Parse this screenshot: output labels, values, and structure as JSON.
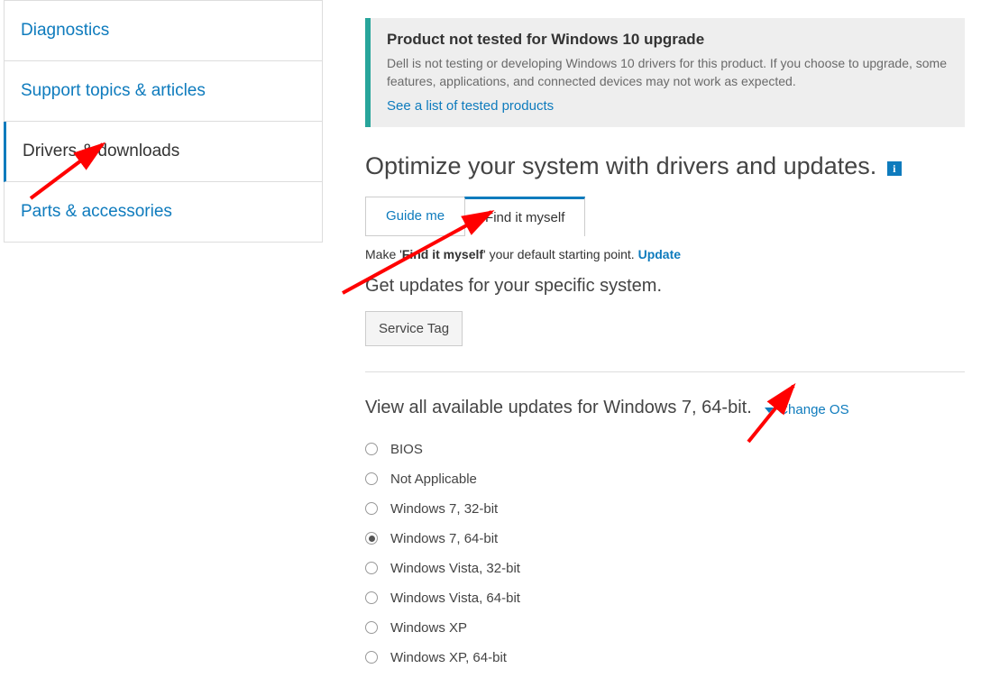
{
  "sidebar": {
    "items": [
      {
        "label": "Diagnostics"
      },
      {
        "label": "Support topics & articles"
      },
      {
        "label": "Drivers & downloads"
      },
      {
        "label": "Parts & accessories"
      }
    ],
    "active_index": 2
  },
  "alert": {
    "title": "Product not tested for Windows 10 upgrade",
    "body": "Dell is not testing or developing Windows 10 drivers for this product. If you choose to upgrade, some features, applications, and connected devices may not work as expected.",
    "link": "See a list of tested products"
  },
  "heading": "Optimize your system with drivers and updates.",
  "tabs": {
    "items": [
      {
        "label": "Guide me"
      },
      {
        "label": "Find it myself"
      }
    ],
    "active_index": 1
  },
  "default_line": {
    "prefix": "Make '",
    "bold": "Find it myself",
    "suffix": "' your default starting point. ",
    "link": "Update"
  },
  "sub_heading": "Get updates for your specific system.",
  "service_tag_label": "Service Tag",
  "view_heading": "View all available updates for Windows 7, 64-bit.",
  "change_os_label": "Change OS",
  "os_options": [
    {
      "label": "BIOS",
      "selected": false
    },
    {
      "label": "Not Applicable",
      "selected": false
    },
    {
      "label": "Windows 7, 32-bit",
      "selected": false
    },
    {
      "label": "Windows 7, 64-bit",
      "selected": true
    },
    {
      "label": "Windows Vista, 32-bit",
      "selected": false
    },
    {
      "label": "Windows Vista, 64-bit",
      "selected": false
    },
    {
      "label": "Windows XP",
      "selected": false
    },
    {
      "label": "Windows XP, 64-bit",
      "selected": false
    }
  ],
  "colors": {
    "link": "#0e7bbd",
    "accent_teal": "#28a59b",
    "annotation_red": "#ff0000"
  }
}
